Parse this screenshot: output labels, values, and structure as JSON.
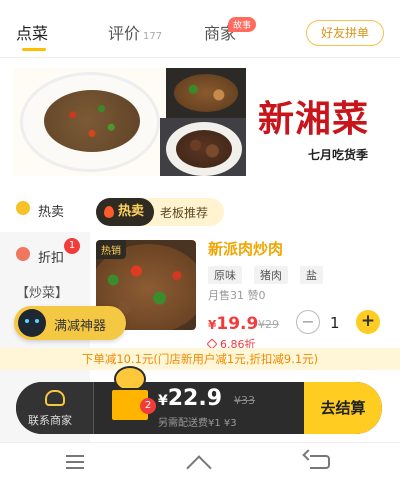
{
  "tabs": {
    "order": "点菜",
    "review": "评价",
    "review_count": "177",
    "merchant": "商家",
    "story_badge": "故事",
    "group_order": "好友拼单"
  },
  "banner": {
    "title": "新湘菜",
    "subtitle": "七月吃货季"
  },
  "sidebar": {
    "items": [
      {
        "label": "热卖",
        "icon": "hot-icon"
      },
      {
        "label": "折扣",
        "icon": "discount-icon",
        "badge": "1"
      },
      {
        "label": "【炒菜】"
      }
    ]
  },
  "section": {
    "hot_label": "热卖",
    "hot_sub": "老板推荐"
  },
  "dish": {
    "tag": "热销",
    "name": "新派肉炒肉",
    "attrs": [
      "原味",
      "猪肉",
      "盐"
    ],
    "sales": "月售31  赞0",
    "price_currency": "¥",
    "price": "19.9",
    "original_price": "¥29",
    "discount": "6.86折",
    "quantity": "1"
  },
  "promo_tool": {
    "label": "满减神器"
  },
  "discount_strip": {
    "text": "下单减10.1元(门店新用户减1元,折扣减9.1元)"
  },
  "cart": {
    "contact_label": "联系商家",
    "count": "2",
    "total_currency": "¥",
    "total": "22.9",
    "total_original": "¥33",
    "delivery": "另需配送费¥1 ¥3",
    "checkout": "去结算"
  },
  "colors": {
    "accent_yellow": "#ffcc22",
    "price_red": "#f23c3c",
    "banner_red": "#c8151b"
  }
}
